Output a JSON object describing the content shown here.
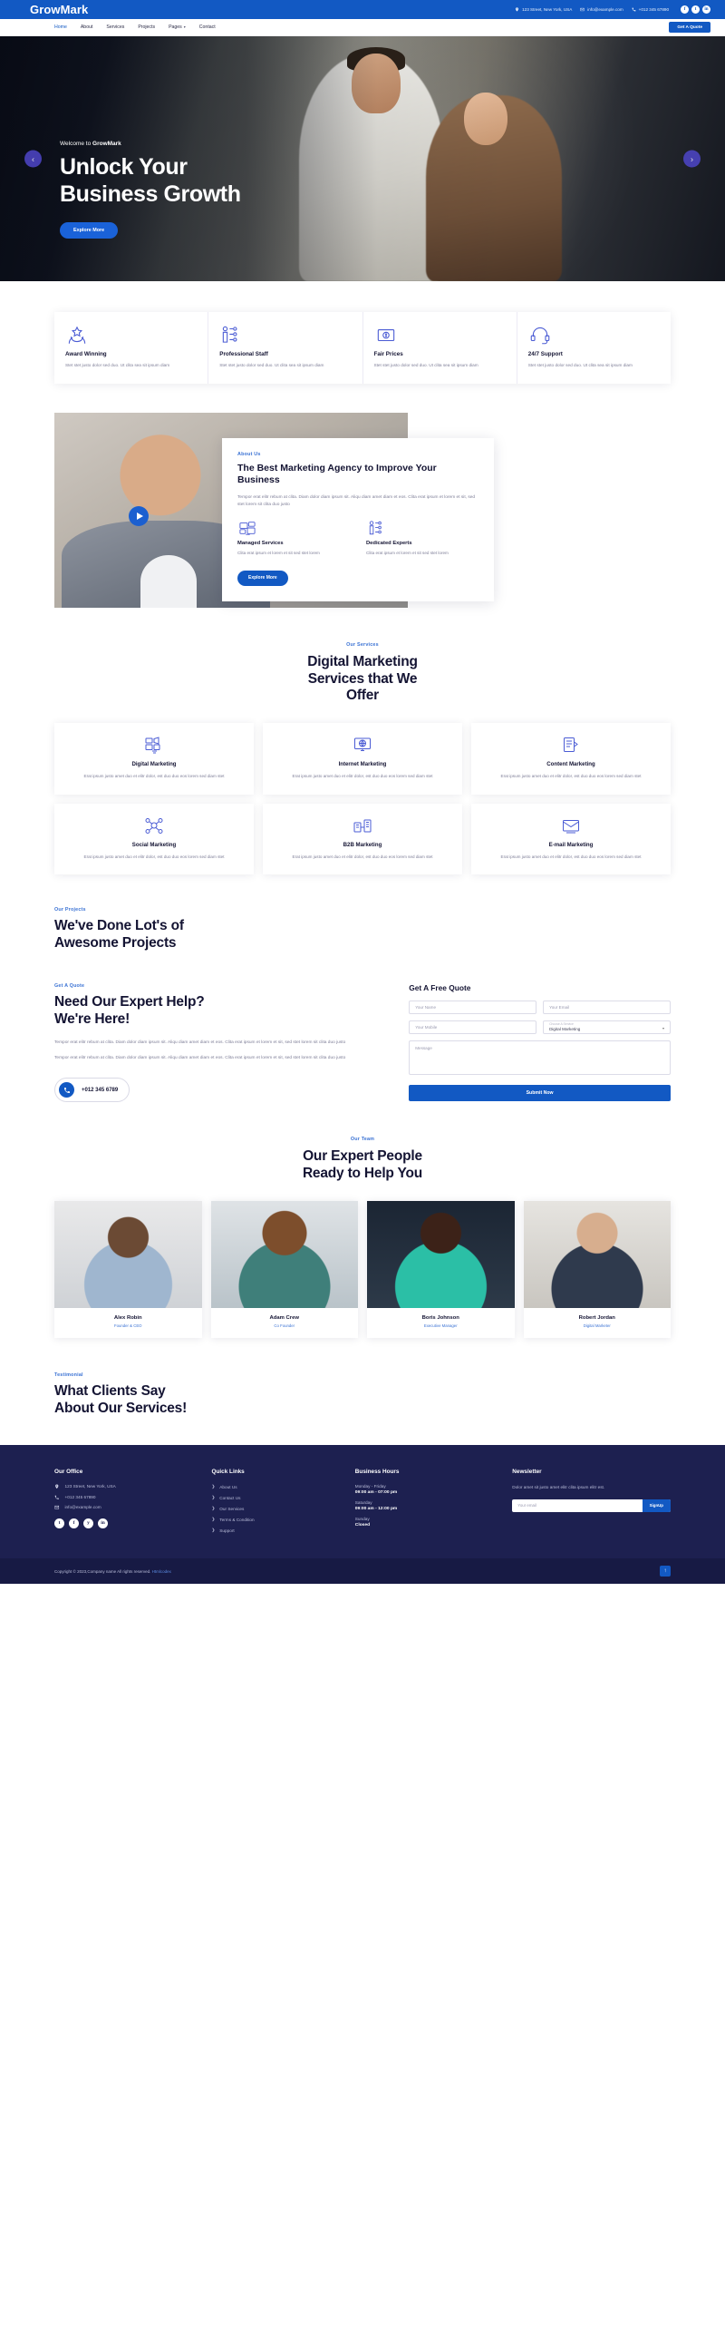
{
  "topbar": {
    "brand": "GrowMark",
    "address": "123 Street, New York, USA",
    "email": "info@example.com",
    "phone": "+012 345 67890",
    "socials": [
      "f",
      "t",
      "in"
    ]
  },
  "nav": {
    "items": [
      "Home",
      "About",
      "Services",
      "Projects",
      "Pages",
      "Contact"
    ],
    "active": "Home",
    "dropdown_item": "Pages",
    "cta": "Get A Quote"
  },
  "hero": {
    "kicker_plain": "Welcome to ",
    "kicker_bold": "GrowMark",
    "title_line1": "Unlock Your",
    "title_line2": "Business Growth",
    "cta": "Explore More",
    "prev_icon": "chevron-left-icon",
    "next_icon": "chevron-right-icon"
  },
  "features": [
    {
      "icon": "award-icon",
      "title": "Award Winning",
      "text": "Stet stet justo dolor sed duo. Ut clita sea sit ipsum diam"
    },
    {
      "icon": "staff-icon",
      "title": "Professional Staff",
      "text": "Stet stet justo dolor sed duo. Ut clita sea sit ipsum diam"
    },
    {
      "icon": "price-icon",
      "title": "Fair Prices",
      "text": "Stet stet justo dolor sed duo. Ut clita sea sit ipsum diam"
    },
    {
      "icon": "support-icon",
      "title": "24/7 Support",
      "text": "Stet stet justo dolor sed duo. Ut clita sea sit ipsum diam"
    }
  ],
  "about": {
    "kicker": "About Us",
    "title": "The Best Marketing Agency to Improve Your Business",
    "paragraph": "Tempor erat elitr rebum at clita. Diam dolor diam ipsum sit. Aliqu diam amet diam et eos. Clita erat ipsum et lorem et sit, sed stet lorem sit clita duo justo",
    "play_icon": "play-icon",
    "columns": [
      {
        "icon": "managed-services-icon",
        "title": "Managed Services",
        "text": "Clita erat ipsum et lorem et sit sed stet lorem"
      },
      {
        "icon": "dedicated-experts-icon",
        "title": "Dedicated Experts",
        "text": "Clita erat ipsum et lorem et sit sed stet lorem"
      }
    ],
    "cta": "Explore More"
  },
  "services": {
    "kicker": "Our Services",
    "title_line1": "Digital Marketing",
    "title_line2": "Services that We",
    "title_line3": "Offer",
    "cards": [
      {
        "icon": "digital-marketing-icon",
        "title": "Digital Marketing",
        "text": "Erat ipsum justo amet duo et elitr dolor, est duo duo eos lorem sed diam stet"
      },
      {
        "icon": "internet-marketing-icon",
        "title": "Internet Marketing",
        "text": "Erat ipsum justo amet duo et elitr dolor, est duo duo eos lorem sed diam stet"
      },
      {
        "icon": "content-marketing-icon",
        "title": "Content Marketing",
        "text": "Erat ipsum justo amet duo et elitr dolor, est duo duo eos lorem sed diam stet"
      },
      {
        "icon": "social-marketing-icon",
        "title": "Social Marketing",
        "text": "Erat ipsum justo amet duo et elitr dolor, est duo duo eos lorem sed diam stet"
      },
      {
        "icon": "b2b-marketing-icon",
        "title": "B2B Marketing",
        "text": "Erat ipsum justo amet duo et elitr dolor, est duo duo eos lorem sed diam stet"
      },
      {
        "icon": "email-marketing-icon",
        "title": "E-mail Marketing",
        "text": "Erat ipsum justo amet duo et elitr dolor, est duo duo eos lorem sed diam stet"
      }
    ]
  },
  "projects": {
    "kicker": "Our Projects",
    "title_line1": "We've Done Lot's of",
    "title_line2": "Awesome Projects"
  },
  "quote": {
    "kicker": "Get A Quote",
    "title_line1": "Need Our Expert Help?",
    "title_line2": "We're Here!",
    "paragraph1": "Tempor erat elitr rebum at clita. Diam dolor diam ipsum sit. Aliqu diam amet diam et eos. Clita erat ipsum et lorem et sit, sed stet lorem sit clita duo justo",
    "paragraph2": "Tempor erat elitr rebum at clita. Diam dolor diam ipsum sit. Aliqu diam amet diam et eos. Clita erat ipsum et lorem et sit, sed stet lorem sit clita duo justo",
    "phone_icon": "phone-icon",
    "phone": "+012 345 6789",
    "form_title": "Get A Free Quote",
    "name_placeholder": "Your Name",
    "email_placeholder": "Your Email",
    "mobile_placeholder": "Your Mobile",
    "select_label": "Choose A Service",
    "select_value": "Digital Marketing",
    "select_chevron": "chevron-down-icon",
    "message_placeholder": "Message",
    "submit": "Submit Now"
  },
  "team": {
    "kicker": "Our Team",
    "title_line1": "Our Expert People",
    "title_line2": "Ready to Help You",
    "members": [
      {
        "name": "Alex Robin",
        "role": "Founder & CEO"
      },
      {
        "name": "Adam Crew",
        "role": "Co Founder"
      },
      {
        "name": "Boris Johnson",
        "role": "Executive Manager"
      },
      {
        "name": "Robert Jordan",
        "role": "Digital Marketer"
      }
    ]
  },
  "testimonial": {
    "kicker": "Testimonial",
    "title_line1": "What Clients Say",
    "title_line2": "About Our Services!"
  },
  "footer": {
    "office": {
      "heading": "Our Office",
      "address": "123 Street, New York, USA",
      "phone": "+012 345 67890",
      "email": "info@example.com",
      "socials": [
        "t",
        "f",
        "y",
        "in"
      ]
    },
    "quick_links": {
      "heading": "Quick Links",
      "items": [
        "About Us",
        "Contact Us",
        "Our Services",
        "Terms & Condition",
        "Support"
      ]
    },
    "business_hours": {
      "heading": "Business Hours",
      "rows": [
        {
          "day": "Monday - Friday",
          "time": "09:00 am - 07:00 pm"
        },
        {
          "day": "Saturday",
          "time": "09:00 am - 12:00 pm"
        },
        {
          "day": "Sunday",
          "time": "Closed"
        }
      ]
    },
    "newsletter": {
      "heading": "Newsletter",
      "text": "Dolor amet sit justo amet elitr clita ipsum elitr est.",
      "placeholder": "Your email",
      "button": "SignUp"
    }
  },
  "copyright": {
    "text": "Copyright © 2023,Company name All rights reserved.",
    "link": "Htmlcodex",
    "totop_icon": "arrow-up-icon"
  },
  "colors": {
    "primary": "#1259c3",
    "accent": "#3a72d4",
    "dark": "#1d2050",
    "darker": "#171a44"
  }
}
